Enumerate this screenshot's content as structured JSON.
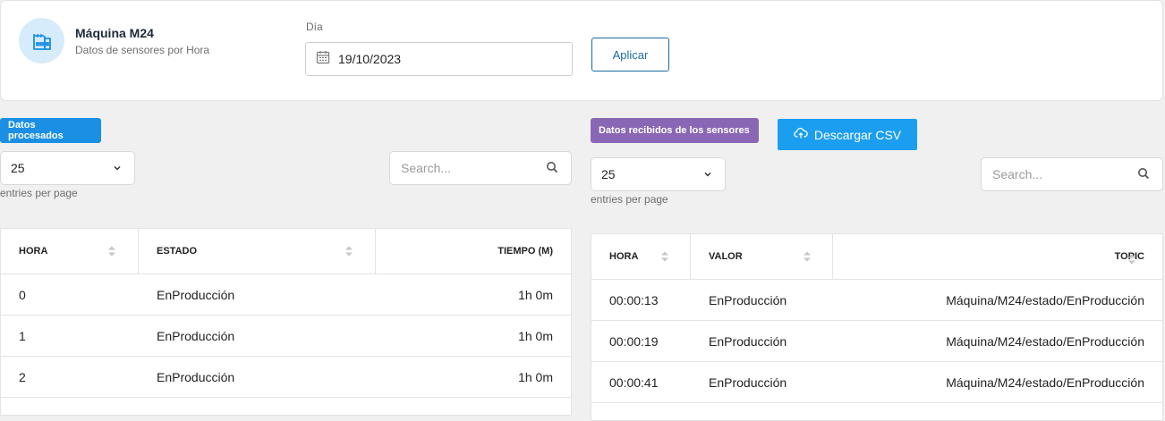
{
  "header": {
    "title": "Máquina M24",
    "subtitle": "Datos de sensores por Hora",
    "date_label": "Día",
    "date_value": "19/10/2023",
    "apply_label": "Aplicar"
  },
  "processed": {
    "badge": "Datos procesados",
    "entries_value": "25",
    "entries_label": "entries per page",
    "search_placeholder": "Search...",
    "columns": [
      "HORA",
      "ESTADO",
      "TIEMPO (M)"
    ],
    "rows": [
      [
        "0",
        "EnProducción",
        "1h 0m"
      ],
      [
        "1",
        "EnProducción",
        "1h 0m"
      ],
      [
        "2",
        "EnProducción",
        "1h 0m"
      ]
    ]
  },
  "received": {
    "badge": "Datos recibidos de los sensores",
    "download_label": "Descargar CSV",
    "entries_value": "25",
    "entries_label": "entries per page",
    "search_placeholder": "Search...",
    "columns": [
      "HORA",
      "VALOR",
      "TOPIC"
    ],
    "rows": [
      [
        "00:00:13",
        "EnProducción",
        "Máquina/M24/estado/EnProducción"
      ],
      [
        "00:00:19",
        "EnProducción",
        "Máquina/M24/estado/EnProducción"
      ],
      [
        "00:00:41",
        "EnProducción",
        "Máquina/M24/estado/EnProducción"
      ]
    ]
  },
  "icons": {
    "machine": "factory-icon",
    "calendar": "calendar-icon",
    "chevron": "chevron-down-icon",
    "search": "search-icon",
    "cloud": "cloud-upload-icon",
    "sort": "sort-icon"
  },
  "colors": {
    "blue_badge": "#1b8fe3",
    "purple_badge": "#8a67b4",
    "csv_button": "#1b9ef0",
    "apply_border": "#1a6ba0",
    "icon_bg": "#d6ecfa"
  }
}
